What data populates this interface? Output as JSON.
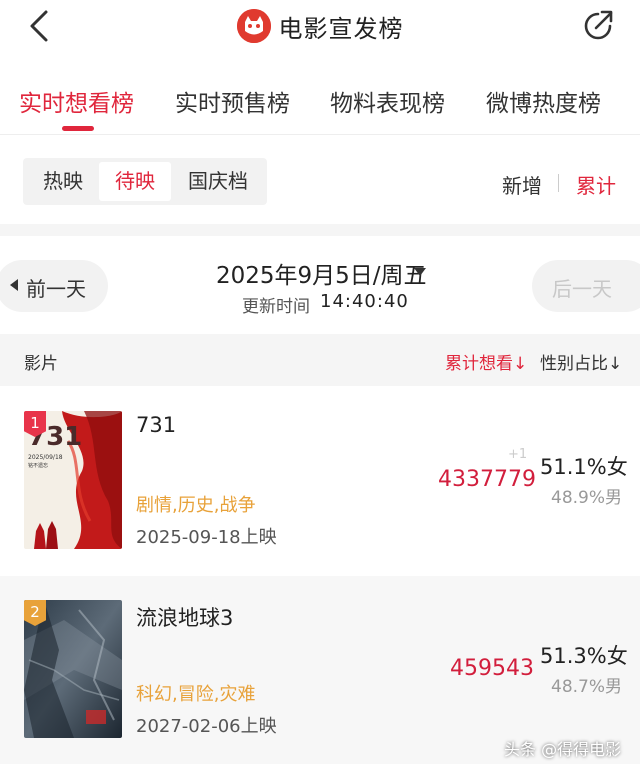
{
  "header": {
    "title": "电影宣发榜"
  },
  "main_tabs": [
    {
      "label": "实时想看榜",
      "active": true
    },
    {
      "label": "实时预售榜",
      "active": false
    },
    {
      "label": "物料表现榜",
      "active": false
    },
    {
      "label": "微博热度榜",
      "active": false
    }
  ],
  "segments": [
    {
      "label": "热映",
      "active": false
    },
    {
      "label": "待映",
      "active": true
    },
    {
      "label": "国庆档",
      "active": false
    }
  ],
  "modes": {
    "new_label": "新增",
    "cumulative_label": "累计",
    "active": "累计"
  },
  "date_nav": {
    "prev_label": "前一天",
    "next_label": "后一天",
    "date": "2025年9月5日/周五",
    "update_label": "更新时间",
    "update_time": "14:40:40"
  },
  "table": {
    "col_film": "影片",
    "col_wish": "累计想看↓",
    "col_gender": "性别占比↓"
  },
  "rows": [
    {
      "rank": "1",
      "name": "731",
      "poster_title": "731",
      "poster_date": "2025/09/18",
      "poster_tagline": "铭不遗忘",
      "genre": "剧情,历史,战争",
      "release": "2025-09-18上映",
      "delta": "+1",
      "wish": "4337779",
      "female": "51.1%女",
      "male": "48.9%男"
    },
    {
      "rank": "2",
      "name": "流浪地球3",
      "genre": "科幻,冒险,灾难",
      "release": "2027-02-06上映",
      "wish": "459543",
      "female": "51.3%女",
      "male": "48.7%男"
    }
  ],
  "watermark": "头条 @得得电影",
  "colors": {
    "accent": "#e0263c",
    "genre": "#e8a23a",
    "rank1": "#e8344a",
    "rank2": "#e8a23a"
  }
}
